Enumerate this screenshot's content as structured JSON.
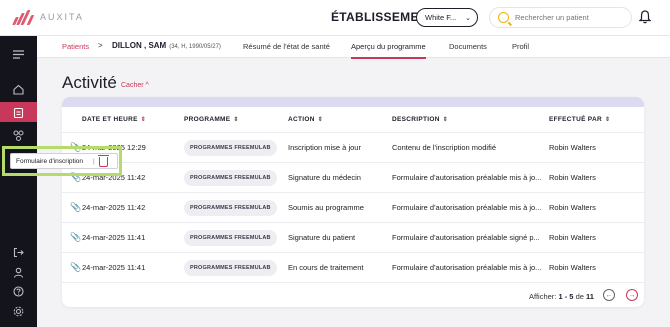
{
  "app": {
    "logo_text": "AUXITA",
    "brand_color": "#c8385a"
  },
  "header": {
    "etablissement_label": "ÉTABLISSEMENT",
    "etablissement_value": "White F...",
    "search_placeholder": "Rechercher un patient"
  },
  "sidebar": {
    "items": [
      {
        "icon": "menu-icon"
      },
      {
        "icon": "home-icon"
      },
      {
        "icon": "clipboard-icon",
        "active": true
      },
      {
        "icon": "network-icon"
      },
      {
        "icon": "logout-icon"
      },
      {
        "icon": "user-icon"
      },
      {
        "icon": "help-icon"
      },
      {
        "icon": "settings-icon"
      }
    ]
  },
  "breadcrumb": {
    "root": "Patients",
    "separator": ">",
    "patient_name": "DILLON , SAM",
    "patient_meta": "(34, H, 1990/05/27)"
  },
  "tabs": [
    {
      "label": "Résumé de l'état de santé",
      "active": false
    },
    {
      "label": "Aperçu du programme",
      "active": true
    },
    {
      "label": "Documents",
      "active": false
    },
    {
      "label": "Profil",
      "active": false
    }
  ],
  "page": {
    "title": "Activité",
    "hide_label": "Cacher ^"
  },
  "table": {
    "columns": [
      "DATE ET HEURE",
      "PROGRAMME",
      "ACTION",
      "DESCRIPTION",
      "EFFECTUÉ PAR"
    ],
    "rows": [
      {
        "date": "24-mar-2025 12:29",
        "program": "PROGRAMMES FREEMULAB",
        "action": "Inscription mise à jour",
        "description": "Contenu de l'inscription modifié",
        "by": "Robin Walters"
      },
      {
        "date": "24-mar-2025 11:42",
        "program": "PROGRAMMES FREEMULAB",
        "action": "Signature du médecin",
        "description": "Formulaire d'autorisation préalable mis à jo...",
        "by": "Robin Walters"
      },
      {
        "date": "24-mar-2025 11:42",
        "program": "PROGRAMMES FREEMULAB",
        "action": "Soumis au programme",
        "description": "Formulaire d'autorisation préalable mis à jo...",
        "by": "Robin Walters"
      },
      {
        "date": "24-mar-2025 11:41",
        "program": "PROGRAMMES FREEMULAB",
        "action": "Signature du patient",
        "description": "Formulaire d'autorisation préalable signé p...",
        "by": "Robin Walters"
      },
      {
        "date": "24-mar-2025 11:41",
        "program": "PROGRAMMES FREEMULAB",
        "action": "En cours de traitement",
        "description": "Formulaire d'autorisation préalable mis à jo...",
        "by": "Robin Walters"
      }
    ]
  },
  "pagination": {
    "prefix": "Afficher: ",
    "range": "1 - 5",
    "of": " de ",
    "total": "11"
  },
  "tooltip": {
    "label": "Formulaire d'inscription",
    "separator": "|"
  }
}
